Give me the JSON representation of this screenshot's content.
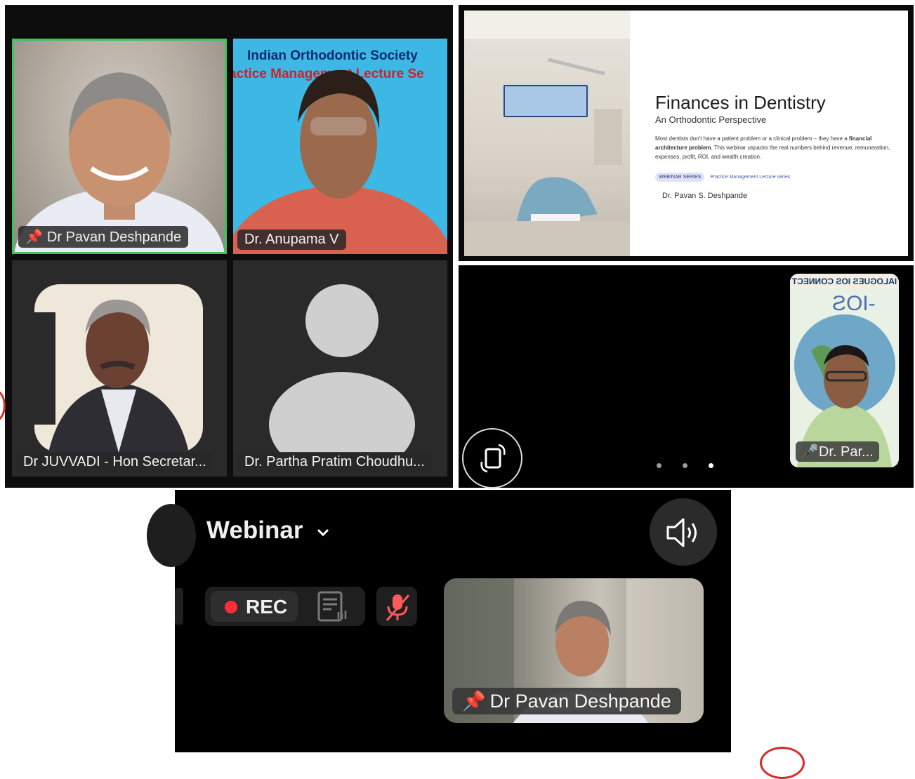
{
  "grid_panel": {
    "tiles": [
      {
        "name": "Dr Pavan Deshpande",
        "pinned": true,
        "active_speaker": true
      },
      {
        "name": "Dr. Anupama V",
        "banner_line1": "Indian Orthodontic Society",
        "banner_line2": "actice Management Lecture Se"
      },
      {
        "name": "Dr JUVVADI - Hon Secretar..."
      },
      {
        "name": "Dr. Partha Pratim Choudhu..."
      }
    ],
    "active_speaker_color": "#3cc45a"
  },
  "slide_panel": {
    "title": "Finances in Dentistry",
    "subtitle": "An Orthodontic Perspective",
    "body_part1": "Most dentists don't have a patient problem or a clinical problem – they have a ",
    "body_bold": "financial architecture problem",
    "body_part2": ". This webinar uspacks the real numbers behind revenue, remuneration, expenses, profit, ROI, and wealth creation.",
    "tag_primary": "WEBINAR SERIES",
    "tag_secondary": "Practice Management Lecture series",
    "author": "Dr. Pavan S. Deshpande"
  },
  "mobile_panel": {
    "pip_name": "Dr. Par...",
    "pip_banner_mirrored": "IALOGUES IOS CONNECT",
    "pip_banner_number": "-IOS",
    "pip_muted": true,
    "page_dots": 3,
    "active_dot": 3,
    "rotate_icon": "rotate-screen-icon"
  },
  "webinar_panel": {
    "title": "Webinar",
    "rec_label": "REC",
    "rec_color": "#ff2d3a",
    "pip_name": "Dr Pavan Deshpande",
    "pip_pinned": true,
    "mic_muted": true,
    "mute_color": "#ff5a5a"
  }
}
